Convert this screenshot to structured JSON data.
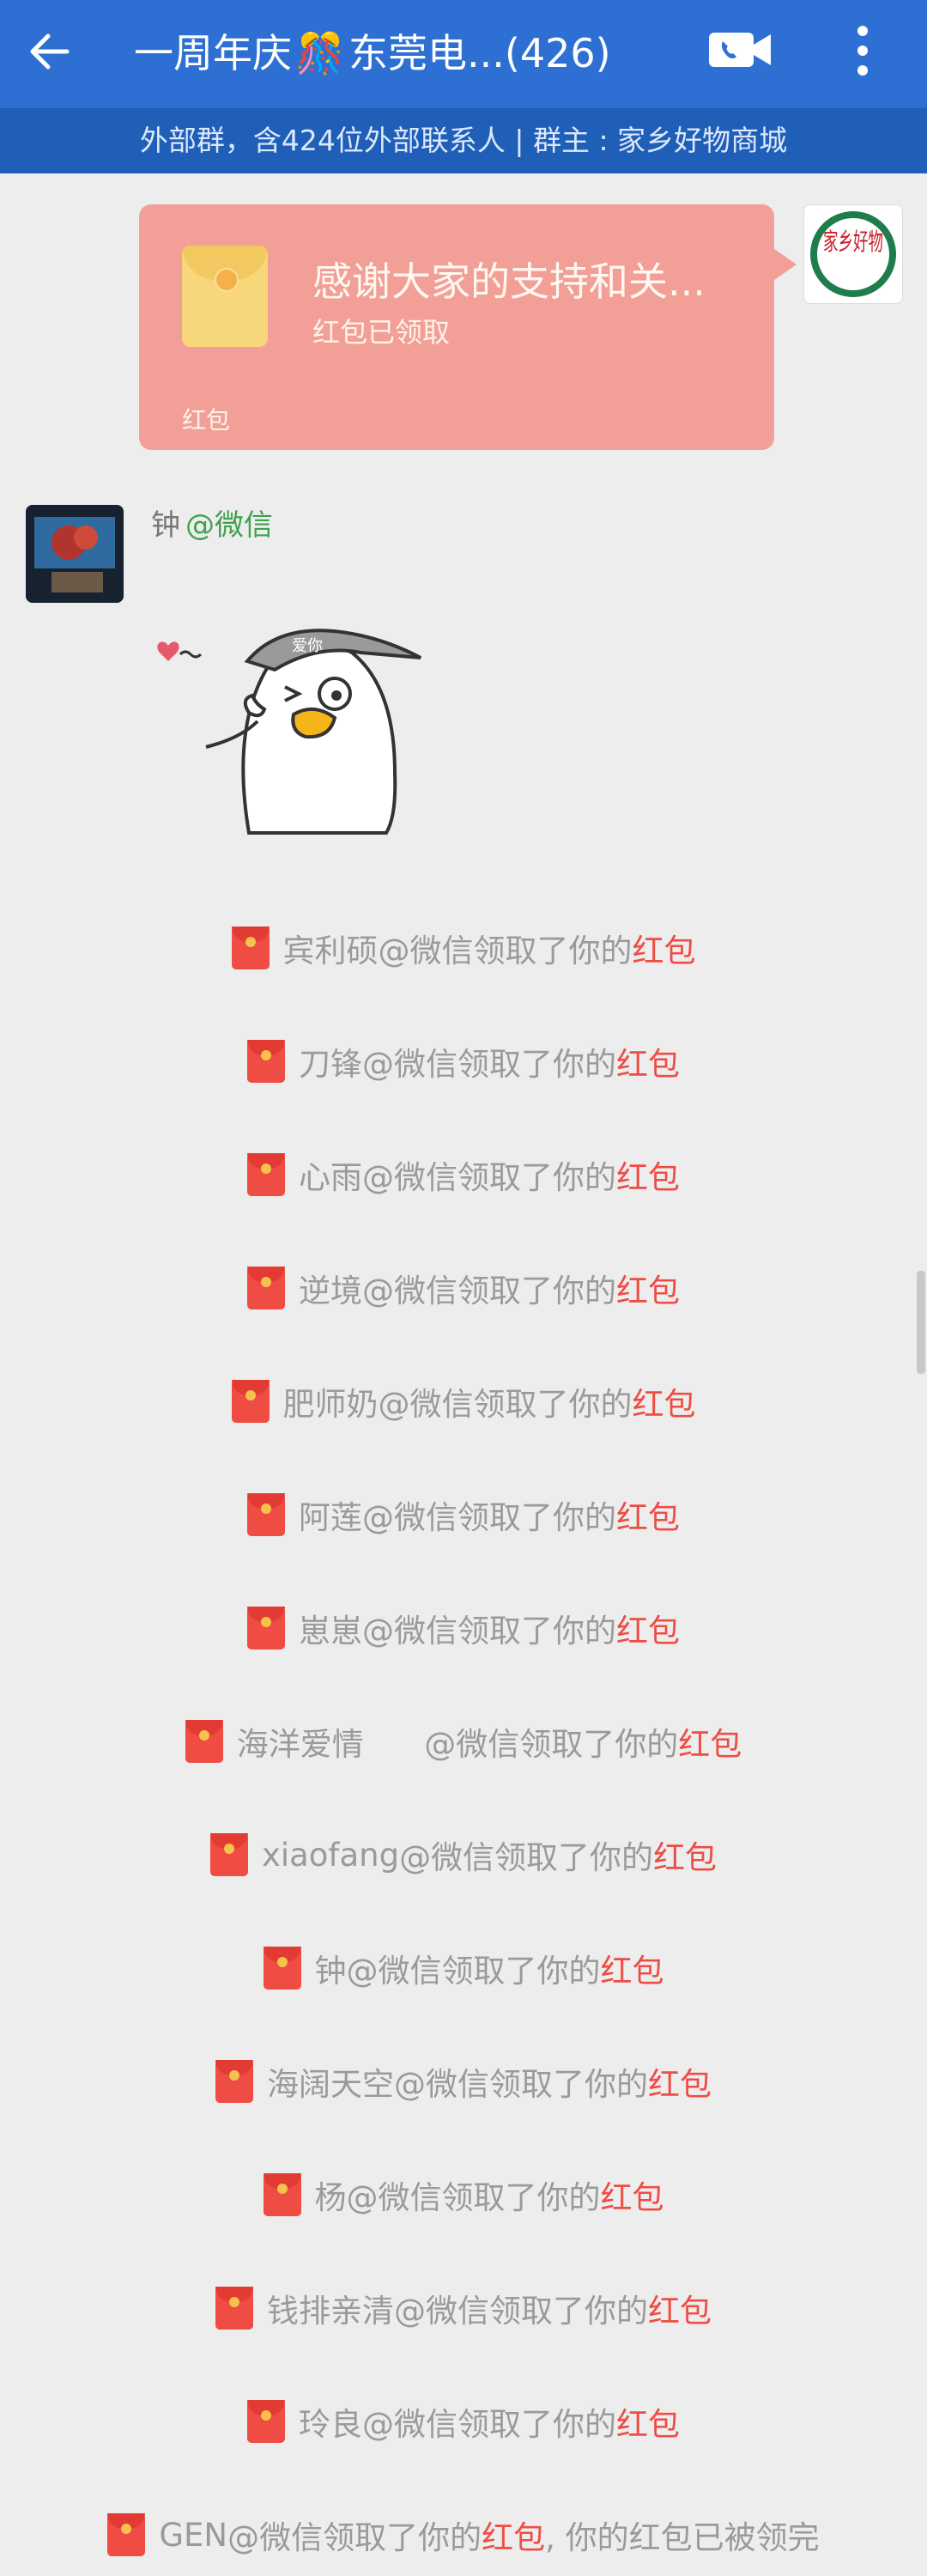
{
  "header": {
    "title_prefix": "一周年庆",
    "title_emoji": "🎊",
    "title_suffix": "东莞电...(426)"
  },
  "subbar": {
    "text": "外部群，含424位外部联系人 | 群主 : 家乡好物商城"
  },
  "red_packet": {
    "title": "感谢大家的支持和关...",
    "status": "红包已领取",
    "footer": "红包"
  },
  "my_avatar": {
    "text": "家乡好物"
  },
  "message": {
    "sender": "钟",
    "mention": "@微信",
    "sticker_text": "爱你"
  },
  "claims": [
    {
      "name": "宾利硕",
      "text": "@微信领取了你的",
      "hb": "红包",
      "suffix": ""
    },
    {
      "name": "刀锋",
      "text": "@微信领取了你的",
      "hb": "红包",
      "suffix": ""
    },
    {
      "name": "心雨",
      "text": "@微信领取了你的",
      "hb": "红包",
      "suffix": ""
    },
    {
      "name": "逆境",
      "text": "@微信领取了你的",
      "hb": "红包",
      "suffix": ""
    },
    {
      "name": "肥师奶",
      "text": "@微信领取了你的",
      "hb": "红包",
      "suffix": ""
    },
    {
      "name": "阿莲",
      "text": "@微信领取了你的",
      "hb": "红包",
      "suffix": ""
    },
    {
      "name": "崽崽",
      "text": "@微信领取了你的",
      "hb": "红包",
      "suffix": ""
    },
    {
      "name": "海洋爱情      ",
      "text": "@微信领取了你的",
      "hb": "红包",
      "suffix": ""
    },
    {
      "name": "xiaofang",
      "text": "@微信领取了你的",
      "hb": "红包",
      "suffix": ""
    },
    {
      "name": "钟",
      "text": "@微信领取了你的",
      "hb": "红包",
      "suffix": ""
    },
    {
      "name": "海阔天空",
      "text": "@微信领取了你的",
      "hb": "红包",
      "suffix": ""
    },
    {
      "name": "杨",
      "text": "@微信领取了你的",
      "hb": "红包",
      "suffix": ""
    },
    {
      "name": "钱排亲清",
      "text": "@微信领取了你的",
      "hb": "红包",
      "suffix": ""
    },
    {
      "name": "玲良",
      "text": "@微信领取了你的",
      "hb": "红包",
      "suffix": ""
    },
    {
      "name": "GEN",
      "text": "@微信领取了你的",
      "hb": "红包",
      "suffix": ", 你的红包已被领完"
    }
  ]
}
